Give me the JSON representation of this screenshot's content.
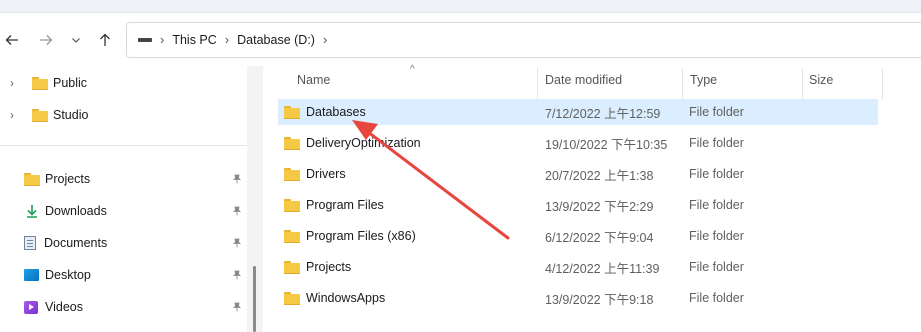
{
  "breadcrumb": {
    "items": [
      "This PC",
      "Database (D:)"
    ],
    "separator": "›"
  },
  "nav": {
    "back_icon": "arrow-left-icon",
    "forward_icon": "arrow-right-icon",
    "recent_icon": "chevron-down-icon",
    "up_icon": "arrow-up-icon",
    "tree_items": [
      {
        "label": "Public"
      },
      {
        "label": "Studio"
      }
    ],
    "quick_access": [
      {
        "label": "Projects",
        "icon": "folder-icon"
      },
      {
        "label": "Downloads",
        "icon": "download-icon"
      },
      {
        "label": "Documents",
        "icon": "documents-icon"
      },
      {
        "label": "Desktop",
        "icon": "desktop-icon"
      },
      {
        "label": "Videos",
        "icon": "videos-icon"
      }
    ]
  },
  "columns": {
    "name": "Name",
    "date": "Date modified",
    "type": "Type",
    "size": "Size"
  },
  "files": [
    {
      "name": "Databases",
      "date": "7/12/2022 上午12:59",
      "type": "File folder",
      "selected": true
    },
    {
      "name": "DeliveryOptimization",
      "date": "19/10/2022 下午10:35",
      "type": "File folder"
    },
    {
      "name": "Drivers",
      "date": "20/7/2022 上午1:38",
      "type": "File folder"
    },
    {
      "name": "Program Files",
      "date": "13/9/2022 下午2:29",
      "type": "File folder"
    },
    {
      "name": "Program Files (x86)",
      "date": "6/12/2022 下午9:04",
      "type": "File folder"
    },
    {
      "name": "Projects",
      "date": "4/12/2022 上午11:39",
      "type": "File folder"
    },
    {
      "name": "WindowsApps",
      "date": "13/9/2022 下午9:18",
      "type": "File folder"
    }
  ],
  "colors": {
    "selection": "#dbeeff",
    "folder": "#f6c945",
    "annotation_arrow": "#e8453c"
  }
}
